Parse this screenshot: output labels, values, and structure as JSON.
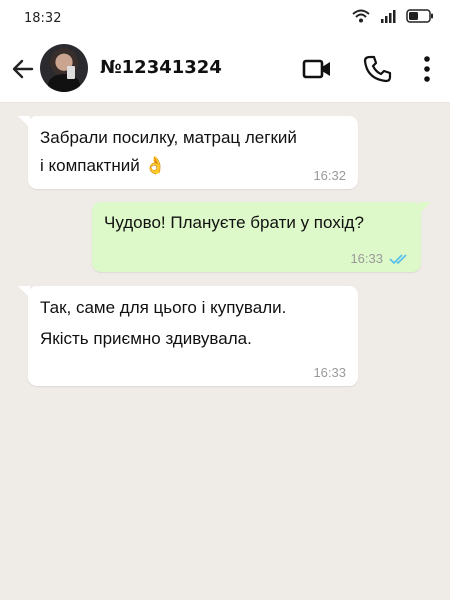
{
  "status_bar": {
    "time": "18:32"
  },
  "header": {
    "contact_name": "№12341324"
  },
  "messages": [
    {
      "direction": "in",
      "text": "Забрали посилку, матрац легкий\nі компактний 👌",
      "time": "16:32"
    },
    {
      "direction": "out",
      "text": "Чудово! Плануєте брати у похід?",
      "time": "16:33",
      "read": true
    },
    {
      "direction": "in",
      "text": "Так, саме для цього і купували.\nЯкість приємно здивувала.",
      "time": "16:33"
    }
  ],
  "colors": {
    "chat_background": "#efebe6",
    "incoming_bubble": "#ffffff",
    "outgoing_bubble": "#ddf8c9",
    "read_ticks": "#53bdeb"
  },
  "icons": [
    "wifi-icon",
    "signal-icon",
    "battery-icon",
    "back-arrow-icon",
    "video-call-icon",
    "phone-call-icon",
    "more-options-icon",
    "double-check-icon"
  ]
}
